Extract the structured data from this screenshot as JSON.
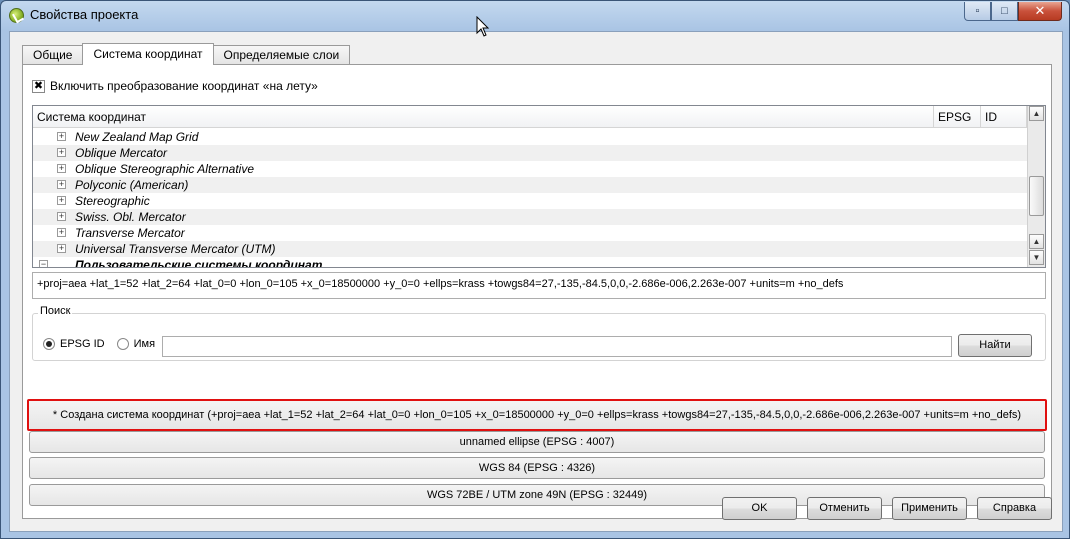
{
  "window": {
    "title": "Свойства проекта",
    "controls": {
      "minimize": "▫",
      "maximize": "□",
      "close": "✕"
    }
  },
  "tabs": [
    {
      "label": "Общие"
    },
    {
      "label": "Система координат"
    },
    {
      "label": "Определяемые слои"
    }
  ],
  "otf": {
    "checked_glyph": "✖",
    "label": "Включить преобразование координат «на лету»"
  },
  "tree": {
    "columns": [
      "Система координат",
      "EPSG",
      "ID"
    ],
    "rows": [
      {
        "label": "New Zealand Map Grid"
      },
      {
        "label": "Oblique Mercator"
      },
      {
        "label": "Oblique Stereographic Alternative"
      },
      {
        "label": "Polyconic (American)"
      },
      {
        "label": "Stereographic"
      },
      {
        "label": "Swiss. Obl. Mercator"
      },
      {
        "label": "Transverse Mercator"
      },
      {
        "label": "Universal Transverse Mercator (UTM)"
      },
      {
        "label": "Пользовательские системы координат"
      }
    ]
  },
  "proj_string": "+proj=aea +lat_1=52 +lat_2=64 +lat_0=0 +lon_0=105 +x_0=18500000 +y_0=0 +ellps=krass +towgs84=27,-135,-84.5,0,0,-2.686e-006,2.263e-007 +units=m +no_defs",
  "search": {
    "group_title": "Поиск",
    "radio_epsg": "EPSG ID",
    "radio_name": "Имя",
    "input_value": "",
    "find_button": "Найти"
  },
  "recent": [
    "* Создана система координат (+proj=aea +lat_1=52 +lat_2=64 +lat_0=0 +lon_0=105 +x_0=18500000 +y_0=0 +ellps=krass +towgs84=27,-135,-84.5,0,0,-2.686e-006,2.263e-007 +units=m +no_defs)",
    "unnamed ellipse (EPSG : 4007)",
    "WGS 84 (EPSG : 4326)",
    "WGS 72BE / UTM zone 49N (EPSG : 32449)"
  ],
  "buttons": {
    "ok": "OK",
    "cancel": "Отменить",
    "apply": "Применить",
    "help": "Справка"
  },
  "colors": {
    "highlight_border": "#e01010",
    "title_gradient_top": "#c3d8ef",
    "close_button": "#c9513b"
  },
  "icons": {
    "app": "qgis-logo-icon",
    "expand": "plus-box-icon",
    "cursor": "mouse-pointer-icon"
  }
}
